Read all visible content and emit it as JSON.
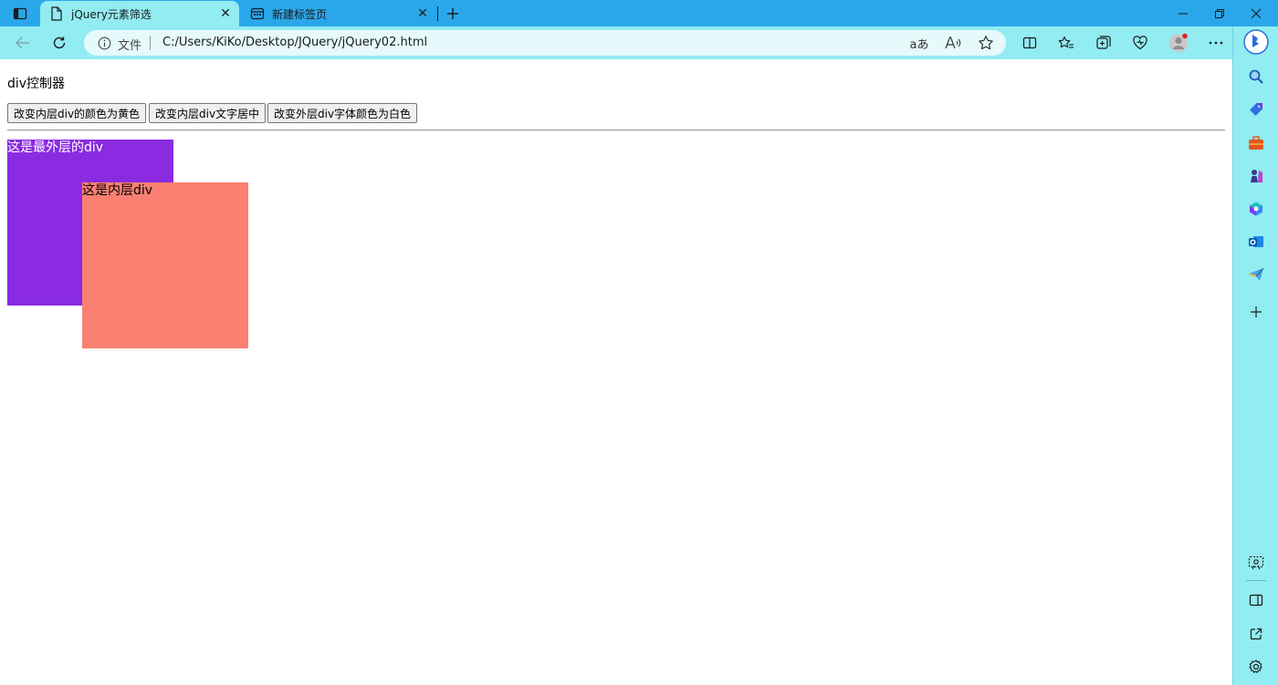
{
  "browser": {
    "tabs": [
      {
        "title": "jQuery元素筛选",
        "active": true
      },
      {
        "title": "新建标签页",
        "active": false
      }
    ],
    "address": {
      "scheme_label": "文件",
      "url": "C:/Users/KiKo/Desktop/JQuery/jQuery02.html"
    },
    "accent_color": "#92ecf2",
    "tabbar_color": "#2aa7ea"
  },
  "page": {
    "controller_title": "div控制器",
    "buttons": [
      {
        "label": "改变内层div的颜色为黄色"
      },
      {
        "label": "改变内层div文字居中"
      },
      {
        "label": "改变外层div字体颜色为白色"
      }
    ],
    "outer_div": {
      "text": "这是最外层的div",
      "background": "#8a2be2",
      "color": "#ffffff"
    },
    "inner_div": {
      "text": "这是内层div",
      "background": "#fa8072",
      "color": "#000000"
    }
  }
}
